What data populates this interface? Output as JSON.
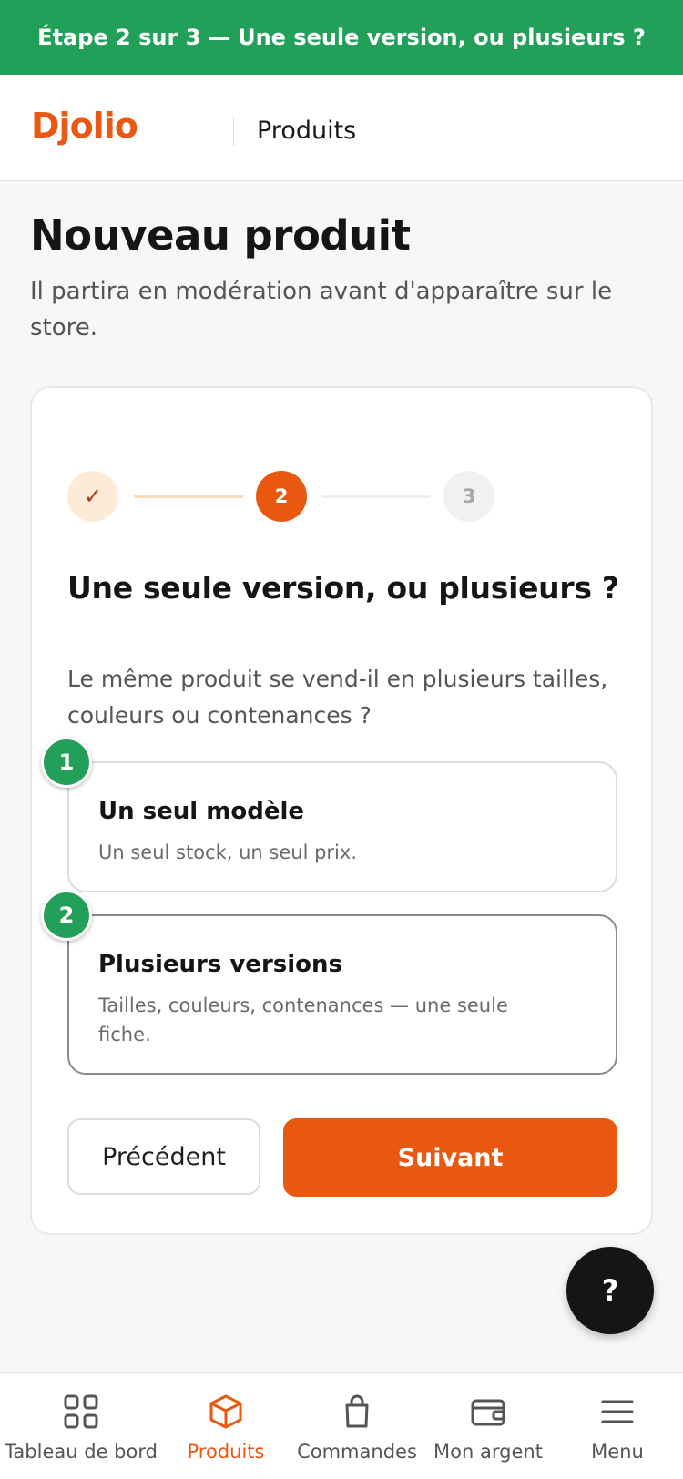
{
  "banner": {
    "text": "Étape 2 sur 3 — Une seule version, ou plusieurs ?"
  },
  "header": {
    "logo": "Djolio",
    "section": "Produits"
  },
  "page": {
    "title": "Nouveau produit",
    "subtitle": "Il partira en modération avant d'apparaître sur le store."
  },
  "stepper": {
    "current": 2,
    "total": 3,
    "steps": [
      {
        "label": "✓",
        "state": "done"
      },
      {
        "label": "2",
        "state": "current"
      },
      {
        "label": "3",
        "state": "upcoming"
      }
    ]
  },
  "question": {
    "title": "Une seule version, ou plusieurs ?",
    "description": "Le même produit se vend-il en plusieurs tailles, couleurs ou contenances ?"
  },
  "options": [
    {
      "badge": "1",
      "label": "Un seul modèle",
      "description": "Un seul stock, un seul prix."
    },
    {
      "badge": "2",
      "label": "Plusieurs versions",
      "description": "Tailles, couleurs, contenances — une seule fiche."
    }
  ],
  "actions": {
    "previous": "Précédent",
    "next": "Suivant"
  },
  "help": {
    "label": "?"
  },
  "nav": {
    "items": [
      {
        "label": "Tableau de bord",
        "icon": "grid-icon",
        "active": false
      },
      {
        "label": "Produits",
        "icon": "box-icon",
        "active": true
      },
      {
        "label": "Commandes",
        "icon": "shopping-bag-icon",
        "active": false
      },
      {
        "label": "Mon argent",
        "icon": "wallet-icon",
        "active": false
      },
      {
        "label": "Menu",
        "icon": "hamburger-icon",
        "active": false
      }
    ]
  },
  "colors": {
    "banner": "#22a05a",
    "accent": "#e8590f",
    "brand": "#e85a14",
    "badge": "#22a05a",
    "fab": "#151515"
  }
}
